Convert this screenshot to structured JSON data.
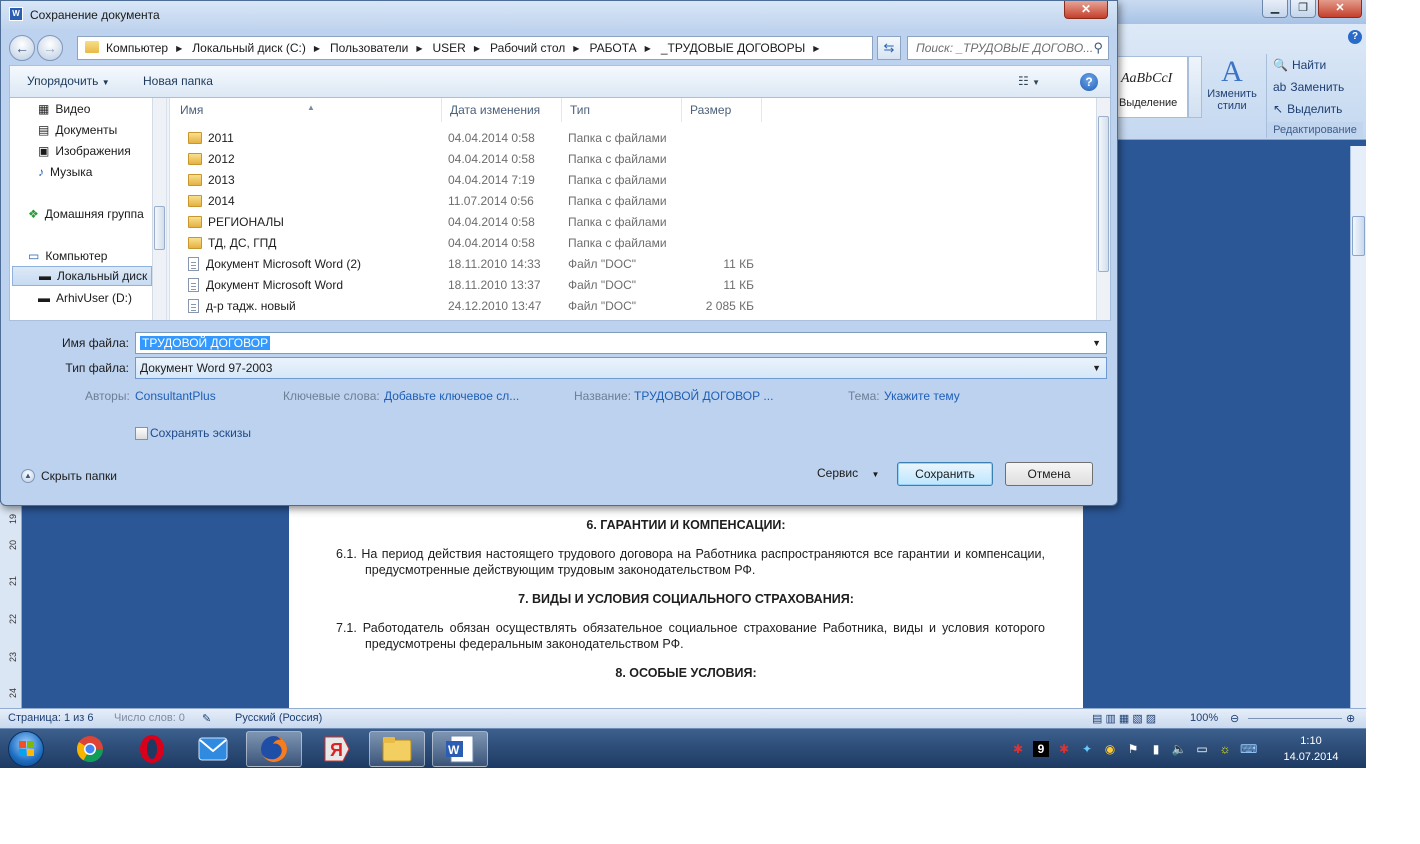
{
  "dialog": {
    "title": "Сохранение документа",
    "close_label": "✕",
    "breadcrumb": [
      "Компьютер",
      "Локальный диск (C:)",
      "Пользователи",
      "USER",
      "Рабочий стол",
      "РАБОТА",
      "_ТРУДОВЫЕ ДОГОВОРЫ"
    ],
    "search_placeholder": "Поиск: _ТРУДОВЫЕ ДОГОВО...",
    "toolbar": {
      "organize": "Упорядочить",
      "new_folder": "Новая папка"
    },
    "nav_items": [
      {
        "label": "Видео",
        "icon": "video-library-icon"
      },
      {
        "label": "Документы",
        "icon": "documents-library-icon"
      },
      {
        "label": "Изображения",
        "icon": "pictures-library-icon"
      },
      {
        "label": "Музыка",
        "icon": "music-library-icon"
      },
      {
        "label": "Домашняя группа",
        "icon": "homegroup-icon"
      },
      {
        "label": "Компьютер",
        "icon": "computer-icon"
      },
      {
        "label": "Локальный диск",
        "icon": "local-disk-icon"
      },
      {
        "label": "ArhivUser (D:)",
        "icon": "drive-icon"
      }
    ],
    "columns": {
      "name": "Имя",
      "date": "Дата изменения",
      "type": "Тип",
      "size": "Размер"
    },
    "files": [
      {
        "name": "2011",
        "date": "04.04.2014 0:58",
        "type": "Папка с файлами",
        "size": "",
        "kind": "folder"
      },
      {
        "name": "2012",
        "date": "04.04.2014 0:58",
        "type": "Папка с файлами",
        "size": "",
        "kind": "folder"
      },
      {
        "name": "2013",
        "date": "04.04.2014 7:19",
        "type": "Папка с файлами",
        "size": "",
        "kind": "folder"
      },
      {
        "name": "2014",
        "date": "11.07.2014 0:56",
        "type": "Папка с файлами",
        "size": "",
        "kind": "folder"
      },
      {
        "name": "РЕГИОНАЛЫ",
        "date": "04.04.2014 0:58",
        "type": "Папка с файлами",
        "size": "",
        "kind": "folder"
      },
      {
        "name": "ТД, ДС, ГПД",
        "date": "04.04.2014 0:58",
        "type": "Папка с файлами",
        "size": "",
        "kind": "folder"
      },
      {
        "name": "Документ Microsoft Word (2)",
        "date": "18.11.2010 14:33",
        "type": "Файл \"DOC\"",
        "size": "11 КБ",
        "kind": "doc"
      },
      {
        "name": "Документ Microsoft Word",
        "date": "18.11.2010 13:37",
        "type": "Файл \"DOC\"",
        "size": "11 КБ",
        "kind": "doc"
      },
      {
        "name": "д-р тадж. новый",
        "date": "24.12.2010 13:47",
        "type": "Файл \"DOC\"",
        "size": "2 085 КБ",
        "kind": "doc"
      }
    ],
    "filename_label": "Имя файла:",
    "filename_value": "ТРУДОВОЙ ДОГОВОР",
    "filetype_label": "Тип файла:",
    "filetype_value": "Документ Word 97-2003",
    "meta": {
      "authors_label": "Авторы:",
      "authors_value": "ConsultantPlus",
      "keywords_label": "Ключевые слова:",
      "keywords_value": "Добавьте ключевое сл...",
      "title_label": "Название:",
      "title_value": "ТРУДОВОЙ ДОГОВОР ...",
      "subject_label": "Тема:",
      "subject_value": "Укажите тему"
    },
    "thumbnails_label": "Сохранять эскизы",
    "hide_folders_label": "Скрыть папки",
    "tools_label": "Сервис",
    "save_label": "Сохранить",
    "cancel_label": "Отмена"
  },
  "word": {
    "styles_sample": "AaBbCcI",
    "styles_caption": "Выделение",
    "change_styles": "Изменить стили",
    "edit_items": [
      "Найти",
      "Заменить",
      "Выделить"
    ],
    "edit_caption": "Редактирование",
    "ruler_numbers": [
      "19",
      "20",
      "21",
      "22",
      "23",
      "24"
    ],
    "doc": {
      "h6": "6. ГАРАНТИИ И КОМПЕНСАЦИИ:",
      "p61": "6.1.  На период действия настоящего трудового договора на Работника распространяются все гарантии и компенсации, предусмотренные действующим трудовым законодательством РФ.",
      "h7": "7. ВИДЫ И УСЛОВИЯ  СОЦИАЛЬНОГО  СТРАХОВАНИЯ:",
      "p71": "7.1.  Работодатель обязан осуществлять обязательное социальное страхование Работника, виды и условия которого предусмотрены федеральным законодательством РФ.",
      "h8": "8. ОСОБЫЕ УСЛОВИЯ:"
    },
    "status": {
      "page": "Страница: 1 из 6",
      "words": "Число слов: 0",
      "lang": "Русский (Россия)",
      "zoom": "100%"
    }
  },
  "taskbar": {
    "time": "1:10",
    "date": "14.07.2014",
    "tray_badge": "9"
  }
}
